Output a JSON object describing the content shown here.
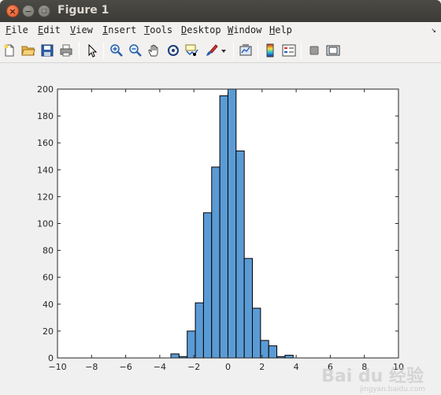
{
  "window": {
    "title": "Figure 1"
  },
  "menu": {
    "items": [
      {
        "label": "File",
        "mnemonic": "F",
        "rest": "ile"
      },
      {
        "label": "Edit",
        "mnemonic": "E",
        "rest": "dit"
      },
      {
        "label": "View",
        "mnemonic": "V",
        "rest": "iew"
      },
      {
        "label": "Insert",
        "mnemonic": "I",
        "rest": "nsert"
      },
      {
        "label": "Tools",
        "mnemonic": "T",
        "rest": "ools"
      },
      {
        "label": "Desktop",
        "mnemonic": "D",
        "rest": "esktop"
      },
      {
        "label": "Window",
        "mnemonic": "W",
        "rest": "indow"
      },
      {
        "label": "Help",
        "mnemonic": "H",
        "rest": "elp"
      }
    ],
    "overflow_arrow": "↘"
  },
  "toolbar": {
    "icons": [
      "new-figure-icon",
      "open-file-icon",
      "save-icon",
      "print-icon",
      "pointer-icon",
      "zoom-in-icon",
      "zoom-out-icon",
      "pan-hand-icon",
      "rotate-3d-icon",
      "data-cursor-icon",
      "brush-icon",
      "dropdown-arrow-icon",
      "link-plot-icon",
      "colorbar-icon",
      "legend-icon",
      "hide-plot-tools-icon",
      "show-plot-tools-icon"
    ]
  },
  "chart_data": {
    "type": "bar",
    "title": "",
    "xlabel": "",
    "ylabel": "",
    "xlim": [
      -10,
      10
    ],
    "ylim": [
      0,
      200
    ],
    "xticks": [
      -10,
      -8,
      -6,
      -4,
      -2,
      0,
      2,
      4,
      6,
      8,
      10
    ],
    "yticks": [
      0,
      20,
      40,
      60,
      80,
      100,
      120,
      140,
      160,
      180,
      200
    ],
    "grid": false,
    "bar_color": "#5b9bd5",
    "bar_edge": "#000000",
    "bin_width": 0.478,
    "bin_edges_start": -3.348,
    "values": [
      3,
      1,
      20,
      41,
      108,
      142,
      195,
      200,
      154,
      74,
      37,
      13,
      9,
      1,
      2
    ]
  },
  "watermark": {
    "text": "Bai du 经验",
    "sub": "jingyan.baidu.com"
  }
}
